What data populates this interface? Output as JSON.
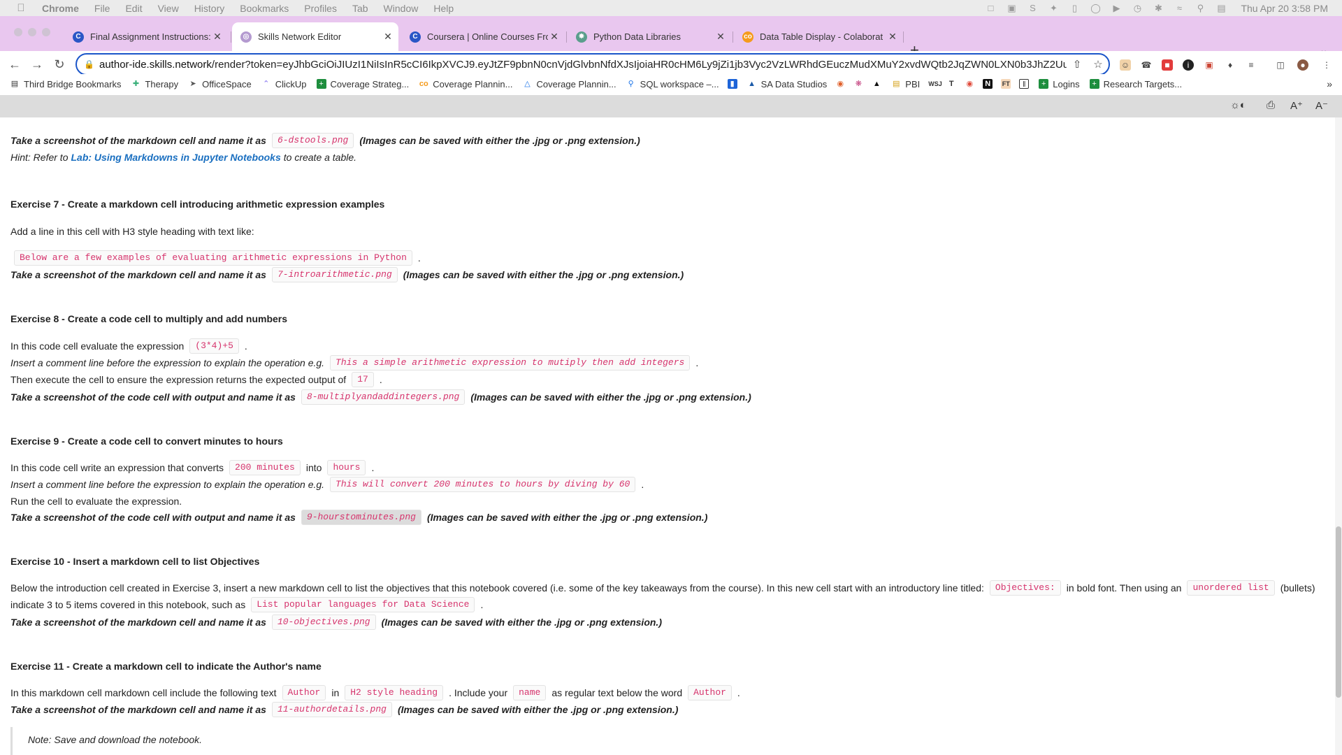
{
  "menubar": {
    "app": "Chrome",
    "items": [
      "File",
      "Edit",
      "View",
      "History",
      "Bookmarks",
      "Profiles",
      "Tab",
      "Window",
      "Help"
    ],
    "clock": "Thu Apr 20  3:58 PM"
  },
  "tabs": [
    {
      "title": "Final Assignment Instructions:",
      "favicon": "coursera-icon",
      "active": false
    },
    {
      "title": "Skills Network Editor",
      "favicon": "skills-network-icon",
      "active": true
    },
    {
      "title": "Coursera | Online Courses Fro",
      "favicon": "coursera-icon",
      "active": false
    },
    {
      "title": "Python Data Libraries",
      "favicon": "openai-icon",
      "active": false
    },
    {
      "title": "Data Table Display - Colaborat",
      "favicon": "colab-icon",
      "active": false
    }
  ],
  "newtab": "+",
  "omnibox": {
    "host": "author-ide.skills.network",
    "path": "/render?token=eyJhbGciOiJIUzI1NiIsInR5cCI6IkpXVCJ9.eyJtZF9pbnN0cnVjdGlvbnNfdXJsIjoiaHR0cHM6Ly9jZi1jb3Vyc2VzLWRhdGEuczMudXMuY2xvdWQtb2JqZWN0LXN0b3JhZ2Uu..."
  },
  "bookmarks": [
    {
      "label": "Third Bridge Bookmarks",
      "icon": "folder-icon"
    },
    {
      "label": "Therapy",
      "icon": "therapy-icon"
    },
    {
      "label": "OfficeSpace",
      "icon": "officespace-icon"
    },
    {
      "label": "ClickUp",
      "icon": "clickup-icon"
    },
    {
      "label": "Coverage Strateg...",
      "icon": "sheets-icon"
    },
    {
      "label": "Coverage Plannin...",
      "icon": "colab-icon"
    },
    {
      "label": "Coverage Plannin...",
      "icon": "drive-icon"
    },
    {
      "label": "SQL workspace –...",
      "icon": "search-icon"
    },
    {
      "label": "",
      "icon": "trello-icon"
    },
    {
      "label": "SA Data Studios",
      "icon": "datastudio-icon"
    },
    {
      "label": "",
      "icon": "github-icon"
    },
    {
      "label": "",
      "icon": "slack-icon"
    },
    {
      "label": "",
      "icon": "hat-icon"
    },
    {
      "label": "PBI",
      "icon": "pbi-icon"
    },
    {
      "label": "",
      "icon": "wsj-icon"
    },
    {
      "label": "",
      "icon": "nyt-icon"
    },
    {
      "label": "",
      "icon": "red-icon"
    },
    {
      "label": "",
      "icon": "notion-icon"
    },
    {
      "label": "",
      "icon": "ft-icon"
    },
    {
      "label": "",
      "icon": "columns-icon"
    },
    {
      "label": "Logins",
      "icon": "sheets-icon"
    },
    {
      "label": "Research Targets...",
      "icon": "sheets-icon"
    }
  ],
  "bm_more": "»",
  "content": {
    "ex6_shot": {
      "pre": "Take a screenshot of the markdown cell and name it as",
      "file": "6-dstools.png",
      "post": "(Images can be saved with either the .jpg or .png extension.)"
    },
    "ex6_hint": {
      "pre": "Hint: Refer to",
      "link": "Lab: Using Markdowns in Jupyter Notebooks",
      "post": "to create a table."
    },
    "ex7": {
      "heading": "Exercise 7 - Create a markdown cell introducing arithmetic expression examples",
      "line1": "Add a line in this cell with H3 style heading with text like:",
      "code": "Below are a few examples of evaluating arithmetic expressions in Python",
      "dot": ".",
      "shot_pre": "Take a screenshot of the markdown cell and name it as",
      "file": "7-introarithmetic.png",
      "shot_post": "(Images can be saved with either the .jpg or .png extension.)"
    },
    "ex8": {
      "heading": "Exercise 8 - Create a code cell to multiply and add numbers",
      "l1_pre": "In this code cell evaluate the expression",
      "l1_code": "(3*4)+5",
      "l1_post": ".",
      "l2_pre": "Insert a comment line before the expression to explain the operation e.g.",
      "l2_code": "This a simple arithmetic expression to mutiply then add integers",
      "l2_post": ".",
      "l3_pre": "Then execute the cell to ensure the expression returns the expected output of",
      "l3_code": "17",
      "l3_post": ".",
      "shot_pre": "Take a screenshot of the code cell with output and name it as",
      "file": "8-multiplyandaddintegers.png",
      "shot_post": "(Images can be saved with either the .jpg or .png extension.)"
    },
    "ex9": {
      "heading": "Exercise 9 - Create a code cell to convert minutes to hours",
      "l1_pre": "In this code cell write an expression that converts",
      "l1_code1": "200 minutes",
      "l1_mid": "into",
      "l1_code2": "hours",
      "l1_post": ".",
      "l2_pre": "Insert a comment line before the expression to explain the operation e.g.",
      "l2_code": "This will convert 200 minutes to hours by diving by 60",
      "l2_post": ".",
      "l3": "Run the cell to evaluate the expression.",
      "shot_pre": "Take a screenshot of the code cell with output and name it as",
      "file": "9-hourstominutes.png",
      "shot_post": "(Images can be saved with either the .jpg or .png extension.)"
    },
    "ex10": {
      "heading": "Exercise 10 - Insert a markdown cell to list Objectives",
      "l1_pre": "Below the introduction cell created in Exercise 3, insert a new markdown cell to list the objectives that this notebook covered (i.e. some of the key takeaways from the course). In this new cell start with an introductory line titled:",
      "l1_code1": "Objectives:",
      "l1_mid": "in bold font. Then using an",
      "l1_code2": "unordered list",
      "l1_post": "(bullets)",
      "l2_pre": "indicate 3 to 5 items covered in this notebook, such as",
      "l2_code": "List popular languages for Data Science",
      "l2_post": ".",
      "shot_pre": "Take a screenshot of the markdown cell and name it as",
      "file": "10-objectives.png",
      "shot_post": "(Images can be saved with either the .jpg or .png extension.)"
    },
    "ex11": {
      "heading": "Exercise 11 - Create a markdown cell to indicate the Author's name",
      "l1_pre": "In this markdown cell markdown cell include the following text",
      "l1_code1": "Author",
      "l1_in": "in",
      "l1_code2": "H2 style heading",
      "l1_mid": ". Include your",
      "l1_code3": "name",
      "l1_mid2": "as regular text below the word",
      "l1_code4": "Author",
      "l1_post": ".",
      "shot_pre": "Take a screenshot of the markdown cell and name it as",
      "file": "11-authordetails.png",
      "shot_post": "(Images can be saved with either the .jpg or .png extension.)"
    },
    "note": "Note: Save and download the notebook."
  }
}
